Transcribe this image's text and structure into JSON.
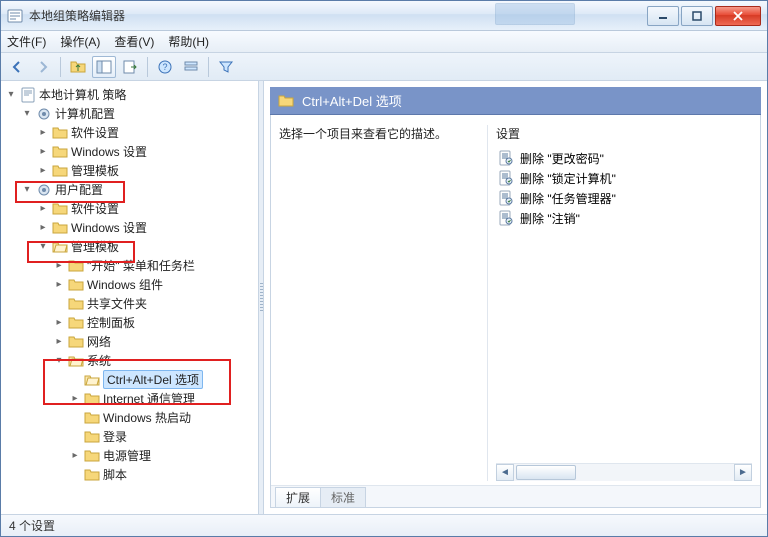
{
  "title": "本地组策略编辑器",
  "menu": {
    "file": "文件(F)",
    "action": "操作(A)",
    "view": "查看(V)",
    "help": "帮助(H)"
  },
  "toolbar_icons": [
    "back",
    "forward",
    "sep",
    "up",
    "props",
    "export",
    "sep",
    "help",
    "filter-opts",
    "sep",
    "filter"
  ],
  "tree": {
    "root": "本地计算机 策略",
    "computer_cfg": "计算机配置",
    "computer_children": [
      "软件设置",
      "Windows 设置",
      "管理模板"
    ],
    "user_cfg": "用户配置",
    "user_software": "软件设置",
    "user_windows": "Windows 设置",
    "admin_templates": "管理模板",
    "start_menu": "\"开始\" 菜单和任务栏",
    "win_components": "Windows 组件",
    "shared_folders": "共享文件夹",
    "control_panel": "控制面板",
    "network": "网络",
    "system": "系统",
    "ctrl_alt_del": "Ctrl+Alt+Del 选项",
    "internet_comm": "Internet 通信管理",
    "win_hotstart": "Windows 热启动",
    "logon": "登录",
    "power_mgmt": "电源管理",
    "scripts": "脚本"
  },
  "right": {
    "header": "Ctrl+Alt+Del 选项",
    "desc_prompt": "选择一个项目来查看它的描述。",
    "settings_header": "设置",
    "items": [
      "删除 \"更改密码\"",
      "删除 \"锁定计算机\"",
      "删除 \"任务管理器\"",
      "删除 \"注销\""
    ],
    "tabs": {
      "extended": "扩展",
      "standard": "标准"
    }
  },
  "status": "4 个设置"
}
